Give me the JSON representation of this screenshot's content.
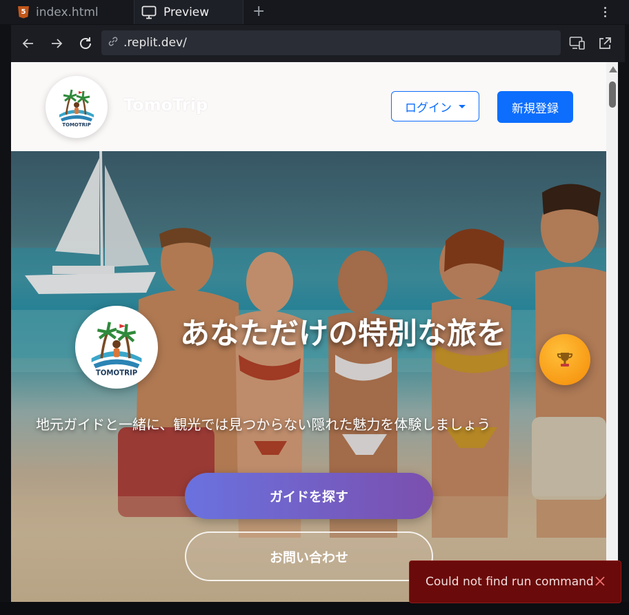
{
  "tabs": [
    {
      "label": "index.html",
      "icon": "html5-icon",
      "active": false
    },
    {
      "label": "Preview",
      "icon": "monitor-icon",
      "active": true
    }
  ],
  "toolbar": {
    "url": ".replit.dev/"
  },
  "site": {
    "brand": "TomoTrip",
    "logo_text": "TOMOTRIP",
    "login_label": "ログイン",
    "signup_label": "新規登録"
  },
  "hero": {
    "title": "あなただけの特別な旅を",
    "subtitle": "地元ガイドと一緒に、観光では見つからない隠れた魅力を体験しましょう",
    "find_guide_label": "ガイドを探す",
    "contact_label": "お問い合わせ"
  },
  "toast": {
    "message": "Could not find run command"
  },
  "colors": {
    "primary": "#0d6efd",
    "toast_bg": "#6b0a0a",
    "trophy": "#f59a0a",
    "cta_start": "#6a72df",
    "cta_end": "#7b4fae"
  }
}
